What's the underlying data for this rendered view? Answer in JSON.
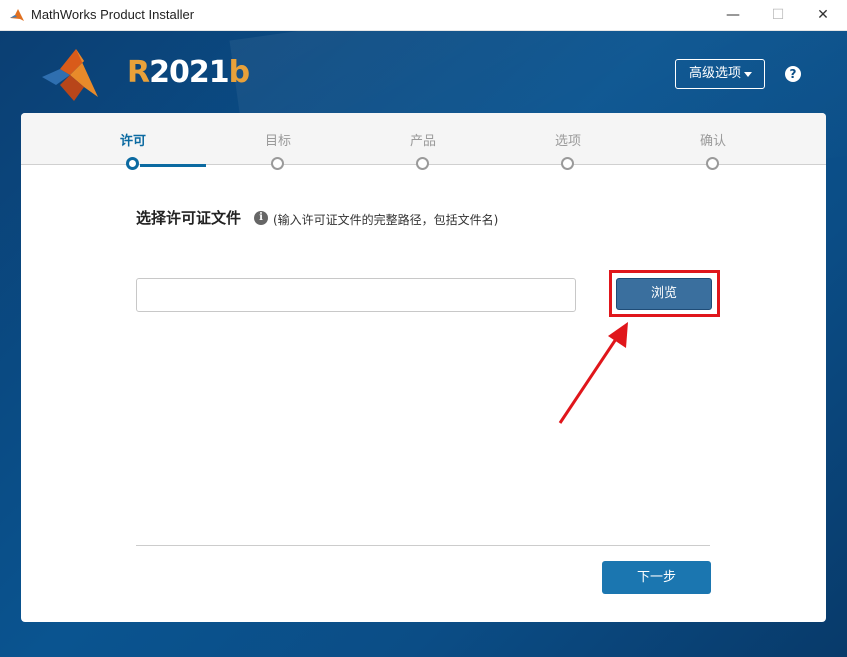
{
  "window": {
    "title": "MathWorks Product Installer",
    "controls": {
      "minimize": "—",
      "maximize": "☐",
      "close": "✕"
    }
  },
  "header": {
    "release": {
      "r": "R",
      "number": "2021",
      "b": "b"
    },
    "advanced_options": "高级选项",
    "help": "?"
  },
  "steps": [
    {
      "label": "许可",
      "active": true
    },
    {
      "label": "目标",
      "active": false
    },
    {
      "label": "产品",
      "active": false
    },
    {
      "label": "选项",
      "active": false
    },
    {
      "label": "确认",
      "active": false
    }
  ],
  "license": {
    "title": "选择许可证文件",
    "info": "i",
    "hint": "(输入许可证文件的完整路径，包括文件名)",
    "file_value": "",
    "browse_label": "浏览"
  },
  "footer": {
    "next_label": "下一步"
  },
  "colors": {
    "accent": "#0b6aa1",
    "highlight": "#e0161b",
    "header_bg": "#0a5490"
  }
}
